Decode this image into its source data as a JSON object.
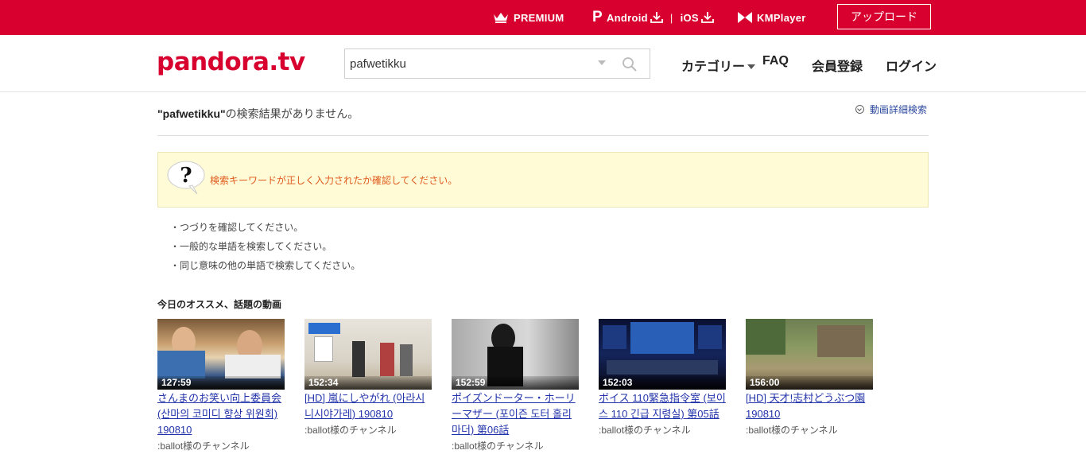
{
  "topbar": {
    "premium": "PREMIUM",
    "android": "Android",
    "separator": "|",
    "ios": "iOS",
    "kmplayer": "KMPlayer",
    "upload": "アップロード"
  },
  "header": {
    "logo": "pandora.tv",
    "search_value": "pafwetikku",
    "nav": {
      "category": "カテゴリー",
      "faq": "FAQ",
      "register": "会員登録",
      "login": "ログイン"
    }
  },
  "result": {
    "query": "\"pafwetikku\"",
    "suffix": "の検索結果がありません。",
    "detail_search": "動画詳細検索"
  },
  "notice": {
    "message": "検索キーワードが正しく入力されたか確認してください。"
  },
  "tips": [
    "・つづりを確認してください。",
    "・一般的な単語を検索してください。",
    "・同じ意味の他の単語で検索してください。"
  ],
  "recommend": {
    "title": "今日のオススメ、話題の動画",
    "videos": [
      {
        "duration": "127:59",
        "title": "さんまのお笑い向上委員会 (산마의 코미디 향상 위원회) 190810",
        "channel": ":ballot様のチャンネル"
      },
      {
        "duration": "152:34",
        "title": "[HD] 嵐にしやがれ (아라시니시야가레) 190810",
        "channel": ":ballot様のチャンネル"
      },
      {
        "duration": "152:59",
        "title": "ポイズンドーター・ホーリーマザー (포이즌 도터 홀리 마더) 第06話",
        "channel": ":ballot様のチャンネル"
      },
      {
        "duration": "152:03",
        "title": "ボイス 110緊急指令室 (보이스 110 긴급 지령실) 第05話",
        "channel": ":ballot様のチャンネル"
      },
      {
        "duration": "156:00",
        "title": "[HD] 天才!志村どうぶつ園 190810",
        "channel": ":ballot様のチャンネル"
      }
    ]
  },
  "colors": {
    "brand_red": "#d7002f",
    "notice_bg": "#fffbd6",
    "notice_text": "#e05a1e",
    "link_blue": "#2233aa"
  }
}
